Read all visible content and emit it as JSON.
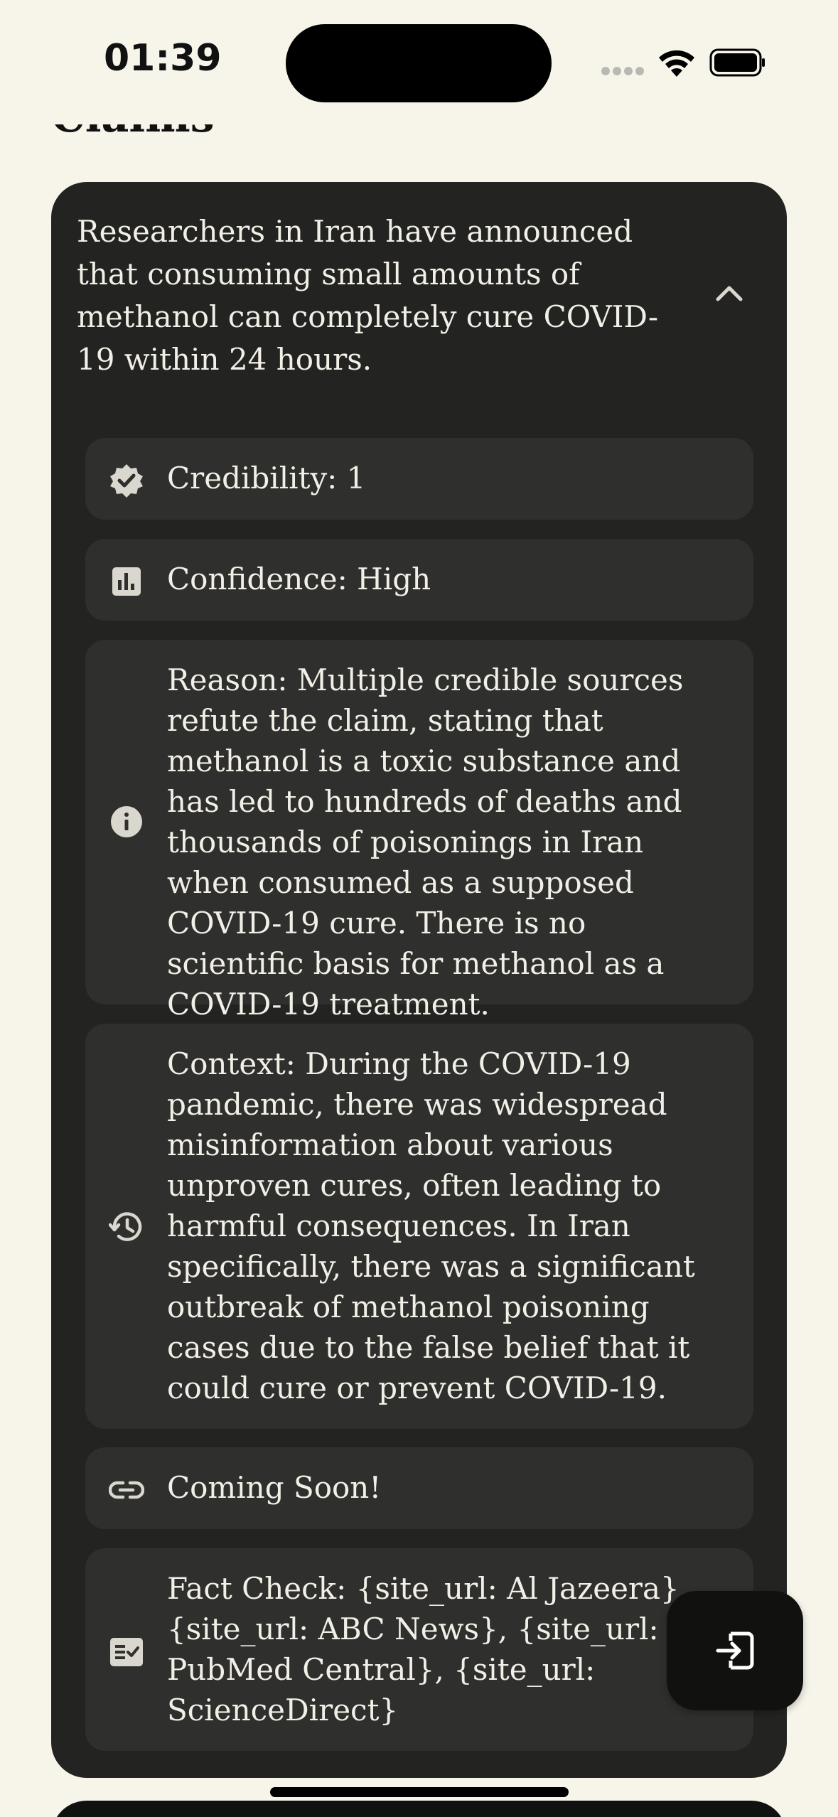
{
  "status_bar": {
    "time": "01:39"
  },
  "section": {
    "title": "Claims"
  },
  "claim_card": {
    "claim_text": "Researchers in Iran have announced that consuming small amounts of methanol can completely cure COVID-19 within 24 hours.",
    "collapse_icon": "chevron-up-icon",
    "credibility": {
      "icon": "verified-badge-icon",
      "text": "Credibility: 1"
    },
    "confidence": {
      "icon": "bar-chart-icon",
      "text": "Confidence: High"
    },
    "reason": {
      "icon": "info-icon",
      "text": "Reason: Multiple credible sources refute the claim, stating that methanol is a toxic substance and has led to hundreds of deaths and thousands of poisonings in Iran when consumed as a supposed COVID-19 cure. There is no scientific basis for methanol as a COVID-19 treatment."
    },
    "context": {
      "icon": "history-icon",
      "text": "Context: During the COVID-19 pandemic, there was widespread misinformation about various unproven cures, often leading to harmful consequences. In Iran specifically, there was a significant outbreak of methanol poisoning cases due to the false belief that it could cure or prevent COVID-19."
    },
    "links": {
      "icon": "link-icon",
      "text": "Coming Soon!"
    },
    "fact_check": {
      "icon": "fact-check-icon",
      "text": "Fact Check: {site_url: Al Jazeera}, {site_url: ABC News}, {site_url: PubMed Central}, {site_url: ScienceDirect}"
    }
  },
  "fab": {
    "icon": "login-icon"
  },
  "colors": {
    "background": "#f7f5ea",
    "card": "#232321",
    "row": "#2f2f2d",
    "text": "#f1efe6"
  }
}
